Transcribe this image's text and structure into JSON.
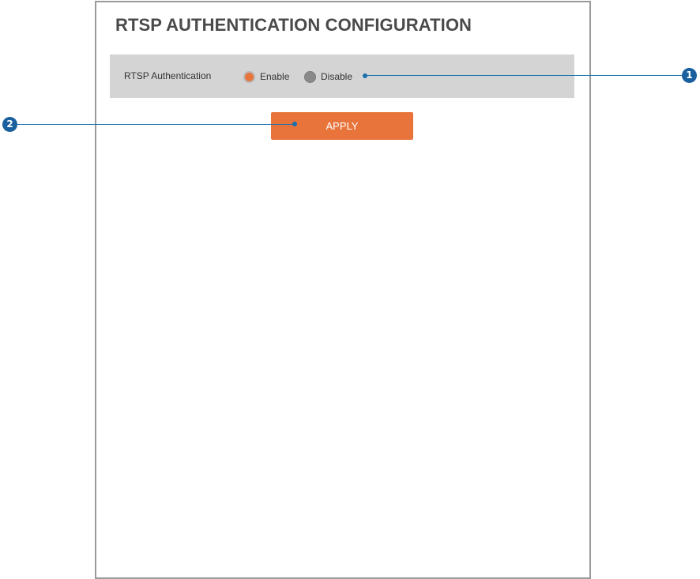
{
  "page": {
    "title": "RTSP AUTHENTICATION CONFIGURATION"
  },
  "rtsp_auth": {
    "label": "RTSP Authentication",
    "options": [
      {
        "label": "Enable",
        "selected": true
      },
      {
        "label": "Disable",
        "selected": false
      }
    ]
  },
  "actions": {
    "apply_label": "APPLY"
  },
  "callouts": [
    {
      "number": "1"
    },
    {
      "number": "2"
    }
  ],
  "colors": {
    "accent": "#e8743b",
    "row_background": "#d4d4d4",
    "callout": "#1a5f9e",
    "panel_border": "#9a9a9a"
  }
}
